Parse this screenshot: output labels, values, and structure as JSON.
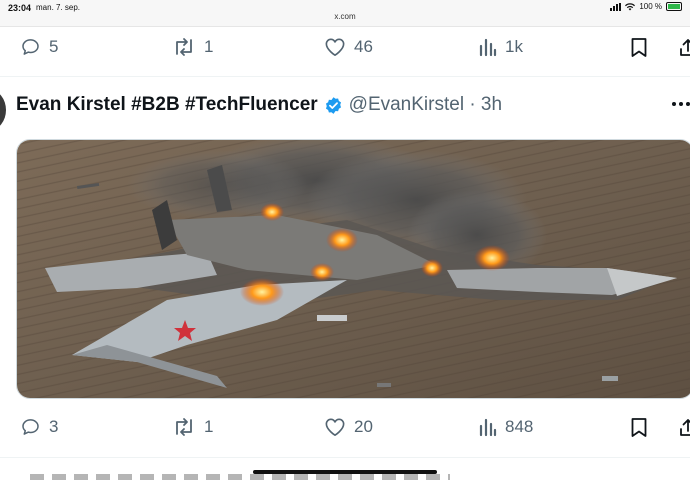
{
  "status_bar": {
    "time": "23:04",
    "date": "man. 7. sep.",
    "url": "x.com",
    "battery": "100 %"
  },
  "prev_tweet_actions": {
    "replies": "5",
    "reposts": "1",
    "likes": "46",
    "views": "1k"
  },
  "tweet": {
    "author_name": "Evan Kirstel #B2B #TechFluencer",
    "handle_time": "@EvanKirstel · 3h",
    "verified_color": "#1d9bf0",
    "actions": {
      "replies": "3",
      "reposts": "1",
      "likes": "20",
      "views": "848"
    }
  },
  "colors": {
    "icon_gray": "#536471",
    "text_dark": "#0f1419",
    "verified": "#1d9bf0"
  }
}
